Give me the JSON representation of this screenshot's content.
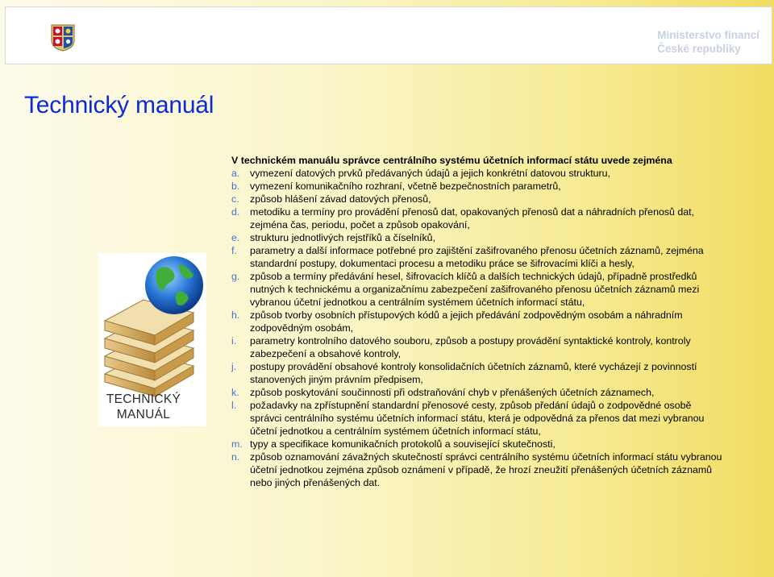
{
  "header": {
    "ministry_line1": "Ministerstvo financí",
    "ministry_line2": "České republiky"
  },
  "title": "Technický manuál",
  "intro": "V technickém manuálu správce centrálního systému účetních informací státu uvede zejména",
  "items": [
    {
      "marker": "a.",
      "text": "vymezení datových prvků předávaných údajů a jejich konkrétní datovou strukturu,"
    },
    {
      "marker": "b.",
      "text": "vymezení komunikačního rozhraní, včetně bezpečnostních parametrů,"
    },
    {
      "marker": "c.",
      "text": "způsob hlášení závad datových přenosů,"
    },
    {
      "marker": "d.",
      "text": "metodiku a termíny pro provádění přenosů dat, opakovaných přenosů dat a náhradních přenosů dat, zejména čas, periodu, počet a způsob opakování,"
    },
    {
      "marker": "e.",
      "text": "strukturu jednotlivých rejstříků a číselníků,"
    },
    {
      "marker": "f.",
      "text": "parametry a další informace potřebné pro zajištění zašifrovaného přenosu účetních záznamů, zejména standardní postupy, dokumentaci procesu a metodiku práce se šifrovacími klíči a hesly,"
    },
    {
      "marker": "g.",
      "text": "způsob a termíny předávání hesel, šifrovacích klíčů a dalších technických údajů, případně prostředků nutných k technickému a organizačnímu zabezpečení zašifrovaného přenosu  účetních záznamů mezi vybranou účetní jednotkou a centrálním systémem účetních informací státu,"
    },
    {
      "marker": "h.",
      "text": "způsob tvorby osobních přístupových kódů a jejich předávání zodpovědným osobám a náhradním zodpovědným osobám,"
    },
    {
      "marker": "i.",
      "text": "parametry kontrolního datového souboru, způsob a postupy provádění syntaktické kontroly, kontroly zabezpečení a obsahové kontroly,"
    },
    {
      "marker": "j.",
      "text": "postupy provádění obsahové kontroly konsolidačních účetních záznamů, které vycházejí z povinností stanovených jiným právním předpisem,"
    },
    {
      "marker": "k.",
      "text": "způsob poskytování součinnosti při odstraňování chyb v přenášených účetních záznamech,"
    },
    {
      "marker": "l.",
      "text": "požadavky na zpřístupnění standardní přenosové cesty, způsob předání údajů o zodpovědné osobě správci centrálního systému účetních informací státu, která je odpovědná za přenos dat mezi vybranou účetní jednotkou a centrálním systémem účetních informací státu,"
    },
    {
      "marker": "m.",
      "text": "typy a specifikace komunikačních protokolů a související skutečnosti,"
    },
    {
      "marker": "n.",
      "text": "způsob oznamování závažných skutečností správci centrálního systému účetních informací státu vybranou účetní jednotkou zejména způsob oznámení v případě, že hrozí zneužití přenášených účetních záznamů nebo jiných přenášených dat."
    }
  ],
  "book": {
    "label_line1": "TECHNICKÝ",
    "label_line2": "MANUÁL"
  },
  "colors": {
    "title": "#0b2bd8",
    "marker": "#4a6fd4",
    "ministry_text": "#c9d1e0"
  }
}
